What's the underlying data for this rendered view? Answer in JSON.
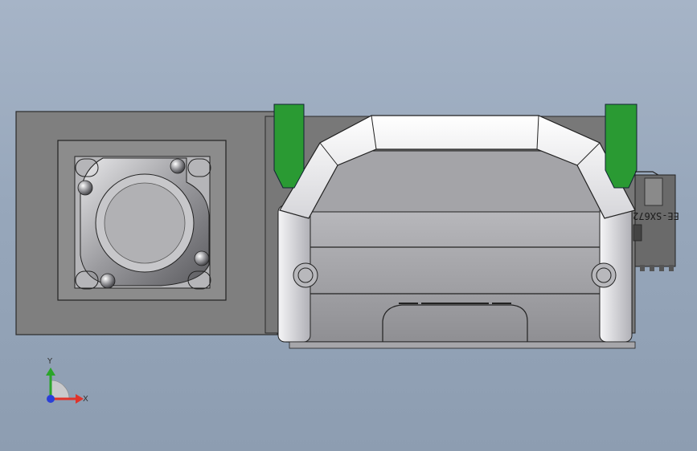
{
  "viewport": {
    "background_top": "#a6b4c7",
    "background_bottom": "#8d9db1"
  },
  "model": {
    "part_marking": "EE-SX672",
    "colors": {
      "base_plate": "#7f7f7f",
      "housing": "#a9a9ad",
      "handle": "#f2f2f4",
      "clamps": "#2a9a33",
      "connector": "#6a6a6a"
    }
  },
  "triad": {
    "x_label": "X",
    "y_label": "Y",
    "x_color": "#e0332a",
    "y_color": "#2aa52a",
    "z_color": "#2a3fd8"
  }
}
